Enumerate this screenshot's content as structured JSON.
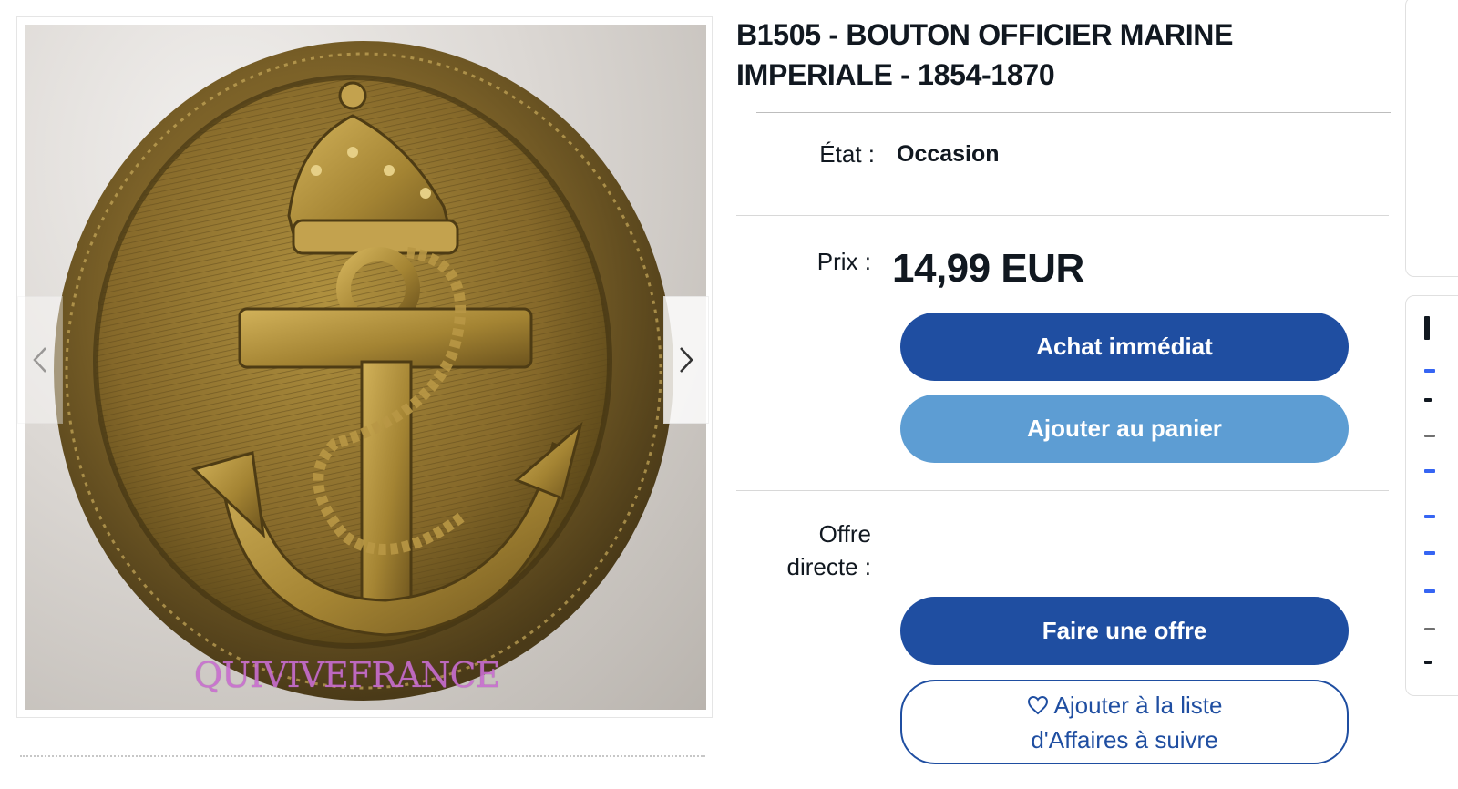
{
  "listing": {
    "title": "B1505 - BOUTON OFFICIER MARINE IMPERIALE - 1854-1870",
    "image_watermark": "QUIVIVEFRANCE"
  },
  "condition": {
    "label": "État :",
    "value": "Occasion"
  },
  "price": {
    "label": "Prix :",
    "value": "14,99 EUR"
  },
  "actions": {
    "buy_now": "Achat immédiat",
    "add_to_cart": "Ajouter au panier",
    "make_offer": "Faire une offre",
    "watchlist_line1": "Ajouter à la liste",
    "watchlist_line2": "d'Affaires à suivre"
  },
  "best_offer": {
    "label_line1": "Offre",
    "label_line2": "directe :"
  },
  "colors": {
    "primary_button": "#1f4ea1",
    "secondary_button": "#5d9dd3",
    "watermark": "#c96ed0"
  },
  "icons": {
    "prev": "chevron-left-icon",
    "next": "chevron-right-icon",
    "watch": "heart-icon"
  }
}
